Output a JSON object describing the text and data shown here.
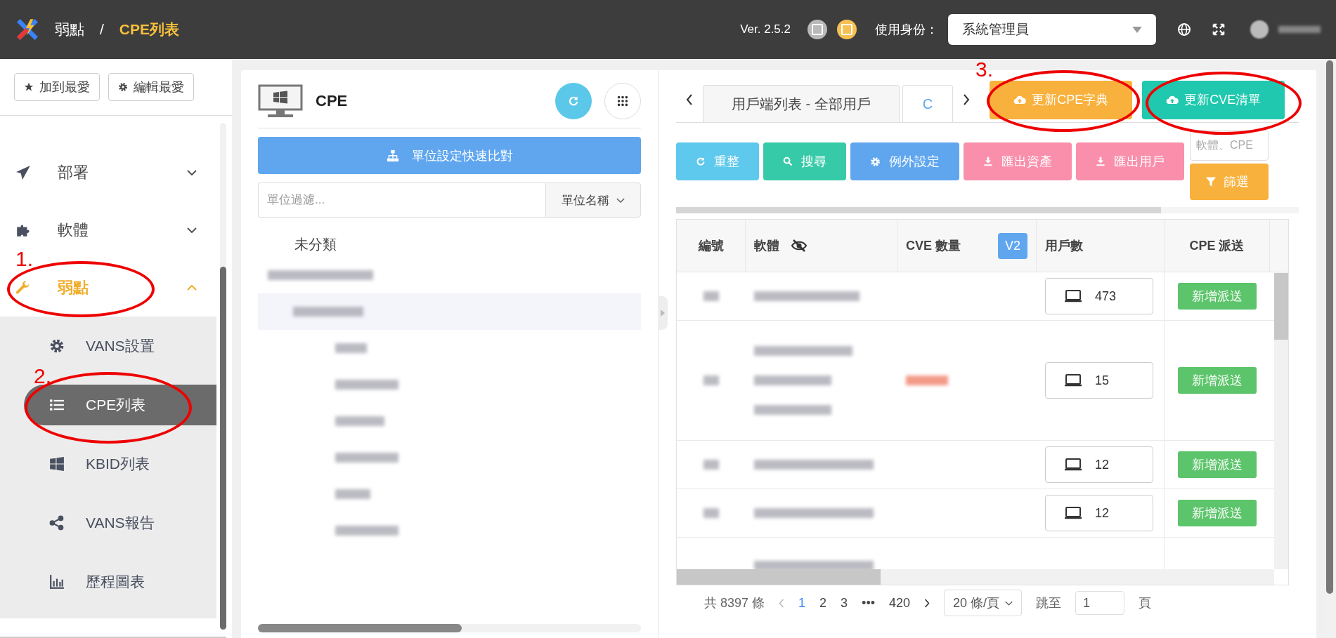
{
  "header": {
    "breadcrumb": [
      {
        "label": "弱點",
        "current": false
      },
      {
        "label": "CPE列表",
        "current": true
      }
    ],
    "separator": "/",
    "version": "Ver. 2.5.2",
    "identity_label": "使用身份：",
    "identity_value": "系統管理員"
  },
  "sidebar": {
    "favorite_buttons": [
      "加到最愛",
      "編輯最愛"
    ],
    "items": [
      {
        "label": "部署",
        "selected": false,
        "expanded": false
      },
      {
        "label": "軟體",
        "selected": false,
        "expanded": false
      },
      {
        "label": "弱點",
        "selected": true,
        "expanded": true,
        "children": [
          {
            "label": "VANS設置",
            "selected": false
          },
          {
            "label": "CPE列表",
            "selected": true
          },
          {
            "label": "KBID列表",
            "selected": false
          },
          {
            "label": "VANS報告",
            "selected": false
          },
          {
            "label": "歷程圖表",
            "selected": false
          }
        ]
      }
    ]
  },
  "left_panel": {
    "title": "CPE",
    "compare_button": "單位設定快速比對",
    "filter_placeholder": "單位過濾...",
    "filter_field": "單位名稱",
    "category": "未分類"
  },
  "right_panel": {
    "tabs": [
      {
        "label": "用戶端列表 - 全部用戶",
        "selected": false
      },
      {
        "label": "C",
        "selected": true
      }
    ],
    "update_buttons": [
      {
        "label": "更新CPE字典",
        "color": "#f8b13c"
      },
      {
        "label": "更新CVE清單",
        "color": "#1fc8ae"
      }
    ],
    "toolbar": [
      {
        "label": "重整",
        "color": "#5ec9ec"
      },
      {
        "label": "搜尋",
        "color": "#37caa8"
      },
      {
        "label": "例外設定",
        "color": "#5fa6ef"
      },
      {
        "label": "匯出資產",
        "color": "#f98fab"
      },
      {
        "label": "匯出用戶",
        "color": "#f98fab"
      }
    ],
    "search_placeholder": "軟體、CPE",
    "filter_button": "篩選",
    "table": {
      "columns": [
        "編號",
        "軟體",
        "CVE 數量",
        "用戶數",
        "CPE 派送"
      ],
      "version_badge": "V2",
      "rows": [
        {
          "users": "473",
          "action": "新增派送"
        },
        {
          "users": "15",
          "action": "新增派送"
        },
        {
          "users": "12",
          "action": "新增派送"
        },
        {
          "users": "12",
          "action": "新增派送"
        }
      ]
    },
    "pagination": {
      "total": "共 8397 條",
      "pages": [
        {
          "label": "1",
          "selected": true
        },
        {
          "label": "2",
          "selected": false
        },
        {
          "label": "3",
          "selected": false
        },
        {
          "label": "•••",
          "selected": false
        },
        {
          "label": "420",
          "selected": false
        }
      ],
      "page_size": "20 條/頁",
      "jump_label": "跳至",
      "jump_value": "1",
      "page_suffix": "頁"
    }
  },
  "annotations": [
    {
      "label": "1."
    },
    {
      "label": "2."
    },
    {
      "label": "3."
    }
  ]
}
